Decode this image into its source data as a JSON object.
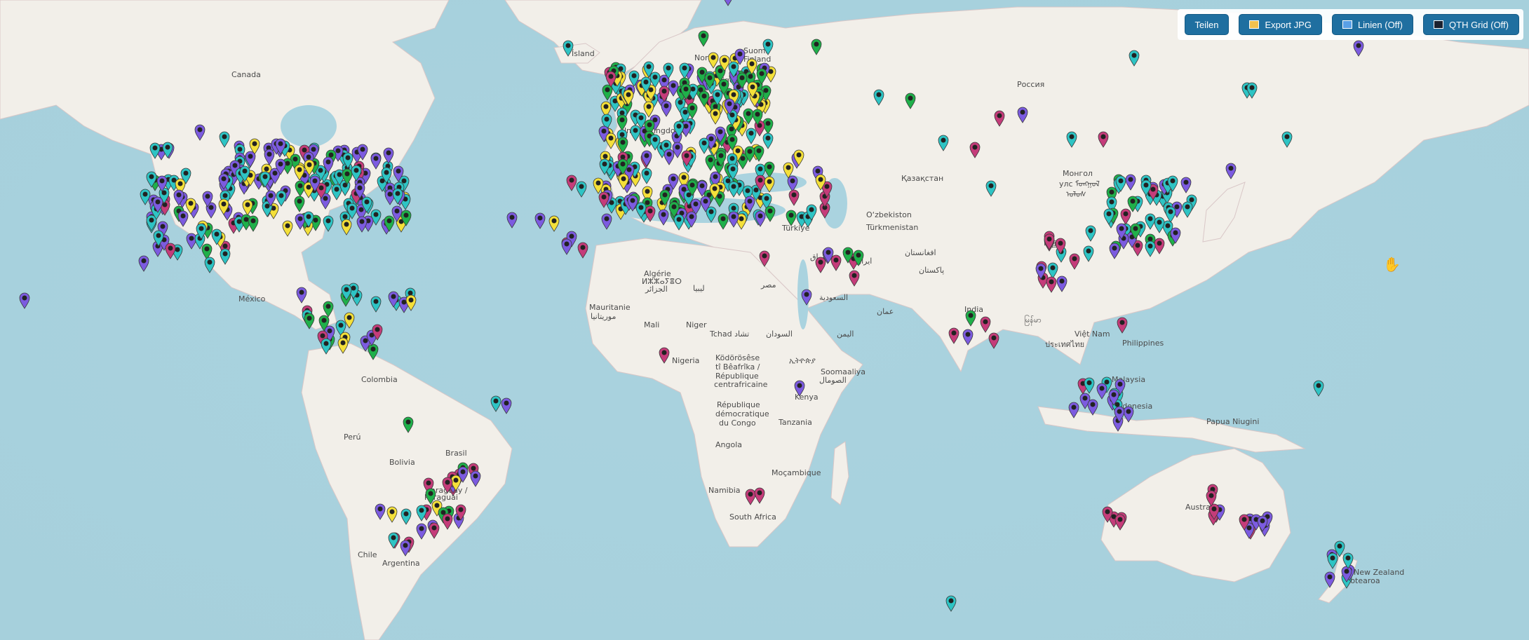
{
  "toolbar": {
    "share": "Teilen",
    "export": "Export JPG",
    "lines": "Linien (Off)",
    "grid": "QTH Grid (Off)"
  },
  "map_labels": [
    {
      "id": "canada",
      "text": "Canada"
    },
    {
      "id": "mexico",
      "text": "México"
    },
    {
      "id": "colombia",
      "text": "Colombia"
    },
    {
      "id": "peru",
      "text": "Perú"
    },
    {
      "id": "bolivia",
      "text": "Bolivia"
    },
    {
      "id": "brasil",
      "text": "Brasil"
    },
    {
      "id": "paraguay",
      "text": "Paraguay /"
    },
    {
      "id": "paraguay2",
      "text": "Paraguái"
    },
    {
      "id": "chile",
      "text": "Chile"
    },
    {
      "id": "argentina",
      "text": "Argentina"
    },
    {
      "id": "iceland",
      "text": "Ísland"
    },
    {
      "id": "norge",
      "text": "Norge"
    },
    {
      "id": "sverige",
      "text": "Sverige"
    },
    {
      "id": "suomi",
      "text": "Suomi"
    },
    {
      "id": "finland",
      "text": "Finland"
    },
    {
      "id": "uk",
      "text": "United Kingdom"
    },
    {
      "id": "russia",
      "text": "Россия"
    },
    {
      "id": "kazakh",
      "text": "Қазақстан"
    },
    {
      "id": "mongol1",
      "text": "Монгол"
    },
    {
      "id": "mongol2",
      "text": "улс ᠮᠣᠩᠭᠣᠯ"
    },
    {
      "id": "mongol3",
      "text": "ᠤᠯᠤᠰ"
    },
    {
      "id": "uzbek",
      "text": "O‘zbekiston"
    },
    {
      "id": "turkmen",
      "text": "Türkmenistan"
    },
    {
      "id": "turkiye",
      "text": "Türkiye"
    },
    {
      "id": "iraq",
      "text": "العراق"
    },
    {
      "id": "iran",
      "text": "ایران"
    },
    {
      "id": "afghan",
      "text": "افغانستان"
    },
    {
      "id": "pakistan",
      "text": "پاکستان"
    },
    {
      "id": "china",
      "text": "中国"
    },
    {
      "id": "india",
      "text": "India"
    },
    {
      "id": "myanmar",
      "text": "မြန်မာ"
    },
    {
      "id": "thailand",
      "text": "ประเทศไทย"
    },
    {
      "id": "vietnam",
      "text": "Việt Nam"
    },
    {
      "id": "philippines",
      "text": "Philippines"
    },
    {
      "id": "malaysia",
      "text": "Malaysia"
    },
    {
      "id": "indonesia",
      "text": "Indonesia"
    },
    {
      "id": "papua",
      "text": "Papua Niugini"
    },
    {
      "id": "australia",
      "text": "Australia"
    },
    {
      "id": "nz1",
      "text": "New Zealand"
    },
    {
      "id": "nz2",
      "text": "Aotearoa"
    },
    {
      "id": "algeria1",
      "text": "Algérie"
    },
    {
      "id": "algeria2",
      "text": "ⵍⵣⵣⴰⵢⴻⵔ"
    },
    {
      "id": "algeria3",
      "text": "الجزائر"
    },
    {
      "id": "libya",
      "text": "ليبيا"
    },
    {
      "id": "egypt",
      "text": "مصر"
    },
    {
      "id": "saudi",
      "text": "السعودية"
    },
    {
      "id": "yemen",
      "text": "اليمن"
    },
    {
      "id": "oman",
      "text": "عمان"
    },
    {
      "id": "maur1",
      "text": "Mauritanie"
    },
    {
      "id": "maur2",
      "text": "موريتانيا"
    },
    {
      "id": "mali",
      "text": "Mali"
    },
    {
      "id": "niger",
      "text": "Niger"
    },
    {
      "id": "tchad",
      "text": "Tchad تشاد"
    },
    {
      "id": "sudan",
      "text": "السودان"
    },
    {
      "id": "nigeria",
      "text": "Nigeria"
    },
    {
      "id": "car1",
      "text": "Ködörösêse"
    },
    {
      "id": "car2",
      "text": "tî Bêafrîka /"
    },
    {
      "id": "car3",
      "text": "République"
    },
    {
      "id": "car4",
      "text": "centrafricaine"
    },
    {
      "id": "ethiopia",
      "text": "ኢትዮጵያ"
    },
    {
      "id": "somalia1",
      "text": "Soomaaliya"
    },
    {
      "id": "somalia2",
      "text": "الصومال"
    },
    {
      "id": "kenya",
      "text": "Kenya"
    },
    {
      "id": "drc1",
      "text": "République"
    },
    {
      "id": "drc2",
      "text": "démocratique"
    },
    {
      "id": "drc3",
      "text": "du Congo"
    },
    {
      "id": "tanzania",
      "text": "Tanzania"
    },
    {
      "id": "angola",
      "text": "Angola"
    },
    {
      "id": "mozambique",
      "text": "Moçambique"
    },
    {
      "id": "namibia",
      "text": "Namibia"
    },
    {
      "id": "southafrica",
      "text": "South Africa"
    }
  ],
  "marker_colors": {
    "cyan": "#2ec4c4",
    "purple": "#7c5be0",
    "green": "#1fb04a",
    "yellow": "#f4e03a",
    "magenta": "#c53c7a"
  },
  "marker_icons": {
    "cyan": "tower-icon",
    "purple": "person-icon",
    "green": "tower-icon",
    "yellow": "plus-icon",
    "magenta": "pin-icon"
  },
  "marker_count_note": ""
}
